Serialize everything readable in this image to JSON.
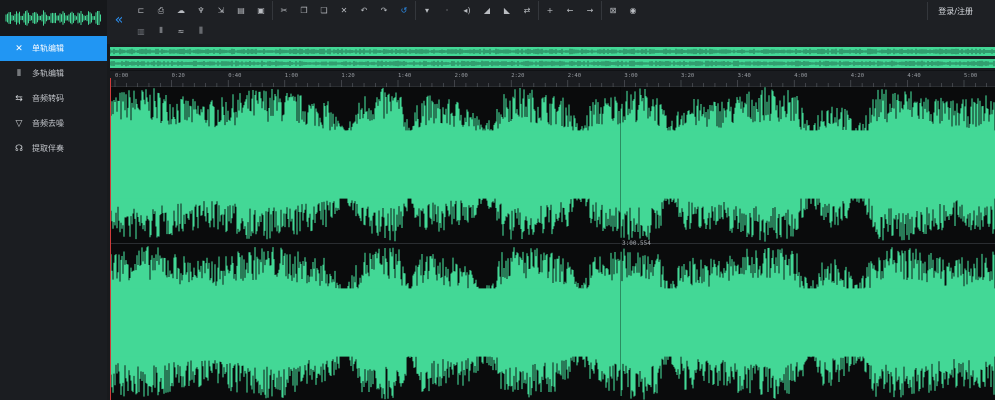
{
  "colors": {
    "accent": "#2196f3",
    "wave": "#43d896",
    "playhead": "#d13b3b"
  },
  "sidebar": {
    "items": [
      {
        "label": "单轨编辑",
        "icon": "scissors-icon",
        "glyph": "✕",
        "active": true
      },
      {
        "label": "多轨编辑",
        "icon": "multitrack-icon",
        "glyph": "⦀",
        "active": false
      },
      {
        "label": "音频转码",
        "icon": "convert-icon",
        "glyph": "⇆",
        "active": false
      },
      {
        "label": "音频去噪",
        "icon": "filter-icon",
        "glyph": "▽",
        "active": false
      },
      {
        "label": "提取伴奏",
        "icon": "headphones-icon",
        "glyph": "☊",
        "active": false
      }
    ]
  },
  "toolbar": {
    "collapse_glyph": "«",
    "login_label": "登录/注册",
    "row1": [
      {
        "icon": "folder-open-icon",
        "glyph": "⊏"
      },
      {
        "icon": "save-icon",
        "glyph": "⎙"
      },
      {
        "icon": "cloud-icon",
        "glyph": "☁"
      },
      {
        "icon": "microphone-icon",
        "glyph": "♆"
      },
      {
        "icon": "export-icon",
        "glyph": "⇲"
      },
      {
        "icon": "document-icon",
        "glyph": "▤"
      },
      {
        "icon": "disk-icon",
        "glyph": "▣"
      },
      {
        "sep": true
      },
      {
        "icon": "cut-icon",
        "glyph": "✂"
      },
      {
        "icon": "copy-icon",
        "glyph": "❐"
      },
      {
        "icon": "paste-icon",
        "glyph": "❏"
      },
      {
        "icon": "delete-icon",
        "glyph": "✕"
      },
      {
        "icon": "undo-icon",
        "glyph": "↶"
      },
      {
        "icon": "redo-icon",
        "glyph": "↷"
      },
      {
        "icon": "loop-icon",
        "glyph": "↺",
        "blue": true
      },
      {
        "sep": true
      },
      {
        "icon": "dropdown-icon",
        "glyph": "▾"
      },
      {
        "icon": "silence-icon",
        "glyph": "·"
      },
      {
        "icon": "volume-icon",
        "glyph": "◂)"
      },
      {
        "icon": "fade-in-icon",
        "glyph": "◢"
      },
      {
        "icon": "fade-out-icon",
        "glyph": "◣"
      },
      {
        "icon": "reverse-icon",
        "glyph": "⇄"
      },
      {
        "sep": true
      },
      {
        "icon": "zoom-in-icon",
        "glyph": "+"
      },
      {
        "icon": "arrow-left-icon",
        "glyph": "←"
      },
      {
        "icon": "arrow-right-icon",
        "glyph": "→"
      },
      {
        "sep": true
      },
      {
        "icon": "fit-icon",
        "glyph": "⊠"
      },
      {
        "icon": "eye-icon",
        "glyph": "◉"
      }
    ],
    "row2": [
      {
        "icon": "equalizer-icon",
        "glyph": "▥",
        "dim": true
      },
      {
        "icon": "bars-icon",
        "glyph": "⦀"
      },
      {
        "icon": "wave-icon",
        "glyph": "≈"
      },
      {
        "icon": "effect-icon",
        "glyph": "⫼"
      }
    ]
  },
  "ruler": {
    "labels": [
      "0:00",
      "0:20",
      "0:40",
      "1:00",
      "1:20",
      "1:40",
      "2:00",
      "2:20",
      "2:40",
      "3:00",
      "3:20",
      "3:40",
      "4:00",
      "4:20",
      "4:40",
      "5:00"
    ]
  },
  "cursor_time": "3:00.554"
}
